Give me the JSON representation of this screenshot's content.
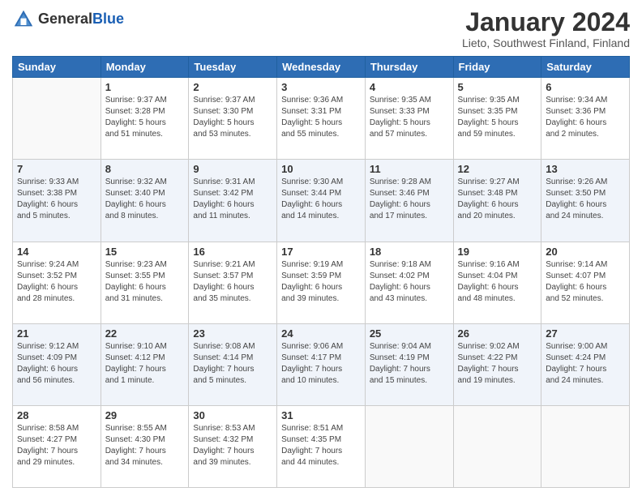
{
  "header": {
    "logo_general": "General",
    "logo_blue": "Blue",
    "month_title": "January 2024",
    "location": "Lieto, Southwest Finland, Finland"
  },
  "weekdays": [
    "Sunday",
    "Monday",
    "Tuesday",
    "Wednesday",
    "Thursday",
    "Friday",
    "Saturday"
  ],
  "weeks": [
    [
      {
        "day": "",
        "sunrise": "",
        "sunset": "",
        "daylight": ""
      },
      {
        "day": "1",
        "sunrise": "Sunrise: 9:37 AM",
        "sunset": "Sunset: 3:28 PM",
        "daylight": "Daylight: 5 hours and 51 minutes."
      },
      {
        "day": "2",
        "sunrise": "Sunrise: 9:37 AM",
        "sunset": "Sunset: 3:30 PM",
        "daylight": "Daylight: 5 hours and 53 minutes."
      },
      {
        "day": "3",
        "sunrise": "Sunrise: 9:36 AM",
        "sunset": "Sunset: 3:31 PM",
        "daylight": "Daylight: 5 hours and 55 minutes."
      },
      {
        "day": "4",
        "sunrise": "Sunrise: 9:35 AM",
        "sunset": "Sunset: 3:33 PM",
        "daylight": "Daylight: 5 hours and 57 minutes."
      },
      {
        "day": "5",
        "sunrise": "Sunrise: 9:35 AM",
        "sunset": "Sunset: 3:35 PM",
        "daylight": "Daylight: 5 hours and 59 minutes."
      },
      {
        "day": "6",
        "sunrise": "Sunrise: 9:34 AM",
        "sunset": "Sunset: 3:36 PM",
        "daylight": "Daylight: 6 hours and 2 minutes."
      }
    ],
    [
      {
        "day": "7",
        "sunrise": "Sunrise: 9:33 AM",
        "sunset": "Sunset: 3:38 PM",
        "daylight": "Daylight: 6 hours and 5 minutes."
      },
      {
        "day": "8",
        "sunrise": "Sunrise: 9:32 AM",
        "sunset": "Sunset: 3:40 PM",
        "daylight": "Daylight: 6 hours and 8 minutes."
      },
      {
        "day": "9",
        "sunrise": "Sunrise: 9:31 AM",
        "sunset": "Sunset: 3:42 PM",
        "daylight": "Daylight: 6 hours and 11 minutes."
      },
      {
        "day": "10",
        "sunrise": "Sunrise: 9:30 AM",
        "sunset": "Sunset: 3:44 PM",
        "daylight": "Daylight: 6 hours and 14 minutes."
      },
      {
        "day": "11",
        "sunrise": "Sunrise: 9:28 AM",
        "sunset": "Sunset: 3:46 PM",
        "daylight": "Daylight: 6 hours and 17 minutes."
      },
      {
        "day": "12",
        "sunrise": "Sunrise: 9:27 AM",
        "sunset": "Sunset: 3:48 PM",
        "daylight": "Daylight: 6 hours and 20 minutes."
      },
      {
        "day": "13",
        "sunrise": "Sunrise: 9:26 AM",
        "sunset": "Sunset: 3:50 PM",
        "daylight": "Daylight: 6 hours and 24 minutes."
      }
    ],
    [
      {
        "day": "14",
        "sunrise": "Sunrise: 9:24 AM",
        "sunset": "Sunset: 3:52 PM",
        "daylight": "Daylight: 6 hours and 28 minutes."
      },
      {
        "day": "15",
        "sunrise": "Sunrise: 9:23 AM",
        "sunset": "Sunset: 3:55 PM",
        "daylight": "Daylight: 6 hours and 31 minutes."
      },
      {
        "day": "16",
        "sunrise": "Sunrise: 9:21 AM",
        "sunset": "Sunset: 3:57 PM",
        "daylight": "Daylight: 6 hours and 35 minutes."
      },
      {
        "day": "17",
        "sunrise": "Sunrise: 9:19 AM",
        "sunset": "Sunset: 3:59 PM",
        "daylight": "Daylight: 6 hours and 39 minutes."
      },
      {
        "day": "18",
        "sunrise": "Sunrise: 9:18 AM",
        "sunset": "Sunset: 4:02 PM",
        "daylight": "Daylight: 6 hours and 43 minutes."
      },
      {
        "day": "19",
        "sunrise": "Sunrise: 9:16 AM",
        "sunset": "Sunset: 4:04 PM",
        "daylight": "Daylight: 6 hours and 48 minutes."
      },
      {
        "day": "20",
        "sunrise": "Sunrise: 9:14 AM",
        "sunset": "Sunset: 4:07 PM",
        "daylight": "Daylight: 6 hours and 52 minutes."
      }
    ],
    [
      {
        "day": "21",
        "sunrise": "Sunrise: 9:12 AM",
        "sunset": "Sunset: 4:09 PM",
        "daylight": "Daylight: 6 hours and 56 minutes."
      },
      {
        "day": "22",
        "sunrise": "Sunrise: 9:10 AM",
        "sunset": "Sunset: 4:12 PM",
        "daylight": "Daylight: 7 hours and 1 minute."
      },
      {
        "day": "23",
        "sunrise": "Sunrise: 9:08 AM",
        "sunset": "Sunset: 4:14 PM",
        "daylight": "Daylight: 7 hours and 5 minutes."
      },
      {
        "day": "24",
        "sunrise": "Sunrise: 9:06 AM",
        "sunset": "Sunset: 4:17 PM",
        "daylight": "Daylight: 7 hours and 10 minutes."
      },
      {
        "day": "25",
        "sunrise": "Sunrise: 9:04 AM",
        "sunset": "Sunset: 4:19 PM",
        "daylight": "Daylight: 7 hours and 15 minutes."
      },
      {
        "day": "26",
        "sunrise": "Sunrise: 9:02 AM",
        "sunset": "Sunset: 4:22 PM",
        "daylight": "Daylight: 7 hours and 19 minutes."
      },
      {
        "day": "27",
        "sunrise": "Sunrise: 9:00 AM",
        "sunset": "Sunset: 4:24 PM",
        "daylight": "Daylight: 7 hours and 24 minutes."
      }
    ],
    [
      {
        "day": "28",
        "sunrise": "Sunrise: 8:58 AM",
        "sunset": "Sunset: 4:27 PM",
        "daylight": "Daylight: 7 hours and 29 minutes."
      },
      {
        "day": "29",
        "sunrise": "Sunrise: 8:55 AM",
        "sunset": "Sunset: 4:30 PM",
        "daylight": "Daylight: 7 hours and 34 minutes."
      },
      {
        "day": "30",
        "sunrise": "Sunrise: 8:53 AM",
        "sunset": "Sunset: 4:32 PM",
        "daylight": "Daylight: 7 hours and 39 minutes."
      },
      {
        "day": "31",
        "sunrise": "Sunrise: 8:51 AM",
        "sunset": "Sunset: 4:35 PM",
        "daylight": "Daylight: 7 hours and 44 minutes."
      },
      {
        "day": "",
        "sunrise": "",
        "sunset": "",
        "daylight": ""
      },
      {
        "day": "",
        "sunrise": "",
        "sunset": "",
        "daylight": ""
      },
      {
        "day": "",
        "sunrise": "",
        "sunset": "",
        "daylight": ""
      }
    ]
  ]
}
